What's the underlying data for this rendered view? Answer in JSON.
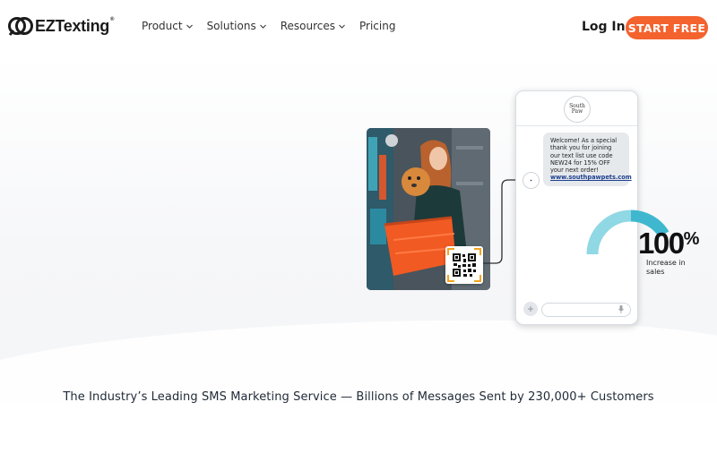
{
  "brand": {
    "name": "EZTexting",
    "mark": "®",
    "accent": "#f4622e"
  },
  "nav": {
    "items": [
      {
        "label": "Product",
        "dropdown": true
      },
      {
        "label": "Solutions",
        "dropdown": true
      },
      {
        "label": "Resources",
        "dropdown": true
      },
      {
        "label": "Pricing",
        "dropdown": false
      }
    ],
    "login_label": "Log In",
    "cta_label": "START FREE"
  },
  "phone": {
    "avatar_label": "South Paw",
    "message_lines": [
      "Welcome! As a special",
      "thank you for joining",
      "our text list use code",
      "NEW24 for 15% OFF",
      "your next order!"
    ],
    "message_link": "www.southpawpets.com"
  },
  "stat": {
    "value": "100",
    "unit": "%",
    "label": "Increase in sales",
    "gauge_color": "#7fd3e0",
    "gauge_dark": "#3fb8cf"
  },
  "tagline": "The Industry’s Leading SMS Marketing Service — Billions of Messages Sent by 230,000+ Customers"
}
